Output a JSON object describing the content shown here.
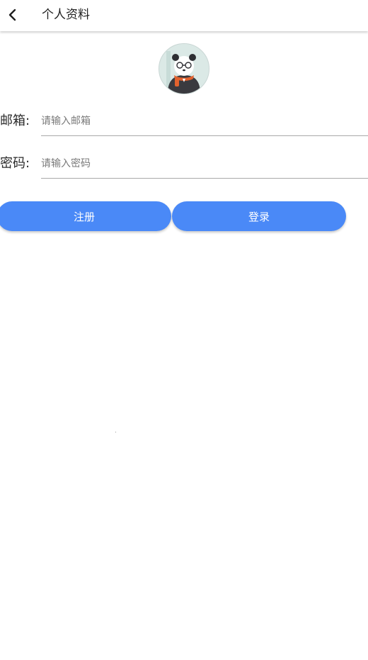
{
  "header": {
    "title": "个人资料",
    "back_icon": "chevron-left-icon"
  },
  "profile": {
    "avatar_icon": "panda-avatar-icon"
  },
  "form": {
    "email": {
      "label": "邮箱:",
      "placeholder": "请输入邮箱",
      "value": ""
    },
    "password": {
      "label": "密码:",
      "placeholder": "请输入密码",
      "value": ""
    }
  },
  "actions": {
    "register_label": "注册",
    "login_label": "登录"
  },
  "colors": {
    "primary": "#4a89f7",
    "background": "#ffffff",
    "divider": "#a9a9a9"
  }
}
